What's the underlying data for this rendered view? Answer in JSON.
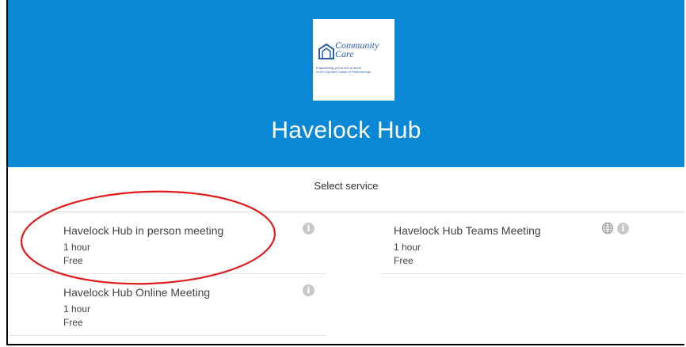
{
  "header": {
    "logo": {
      "brand_line1": "Community",
      "brand_line2": "Care",
      "tagline_line1": "Empowering you to live at home",
      "tagline_line2": "in the City and County of Peterborough"
    },
    "title": "Havelock Hub"
  },
  "services": {
    "section_title": "Select service",
    "items": [
      {
        "name": "Havelock Hub in person meeting",
        "duration": "1 hour",
        "price": "Free",
        "icons": [
          "info-icon"
        ]
      },
      {
        "name": "Havelock Hub Teams Meeting",
        "duration": "1 hour",
        "price": "Free",
        "icons": [
          "globe-icon",
          "info-icon"
        ]
      },
      {
        "name": "Havelock Hub Online Meeting",
        "duration": "1 hour",
        "price": "Free",
        "icons": [
          "info-icon"
        ]
      }
    ]
  },
  "annotation": {
    "color": "#e01b1b",
    "shape": "ellipse"
  },
  "colors": {
    "header_bg": "#0a88d6",
    "text": "#444444",
    "info_icon": "#c8c8c8"
  }
}
